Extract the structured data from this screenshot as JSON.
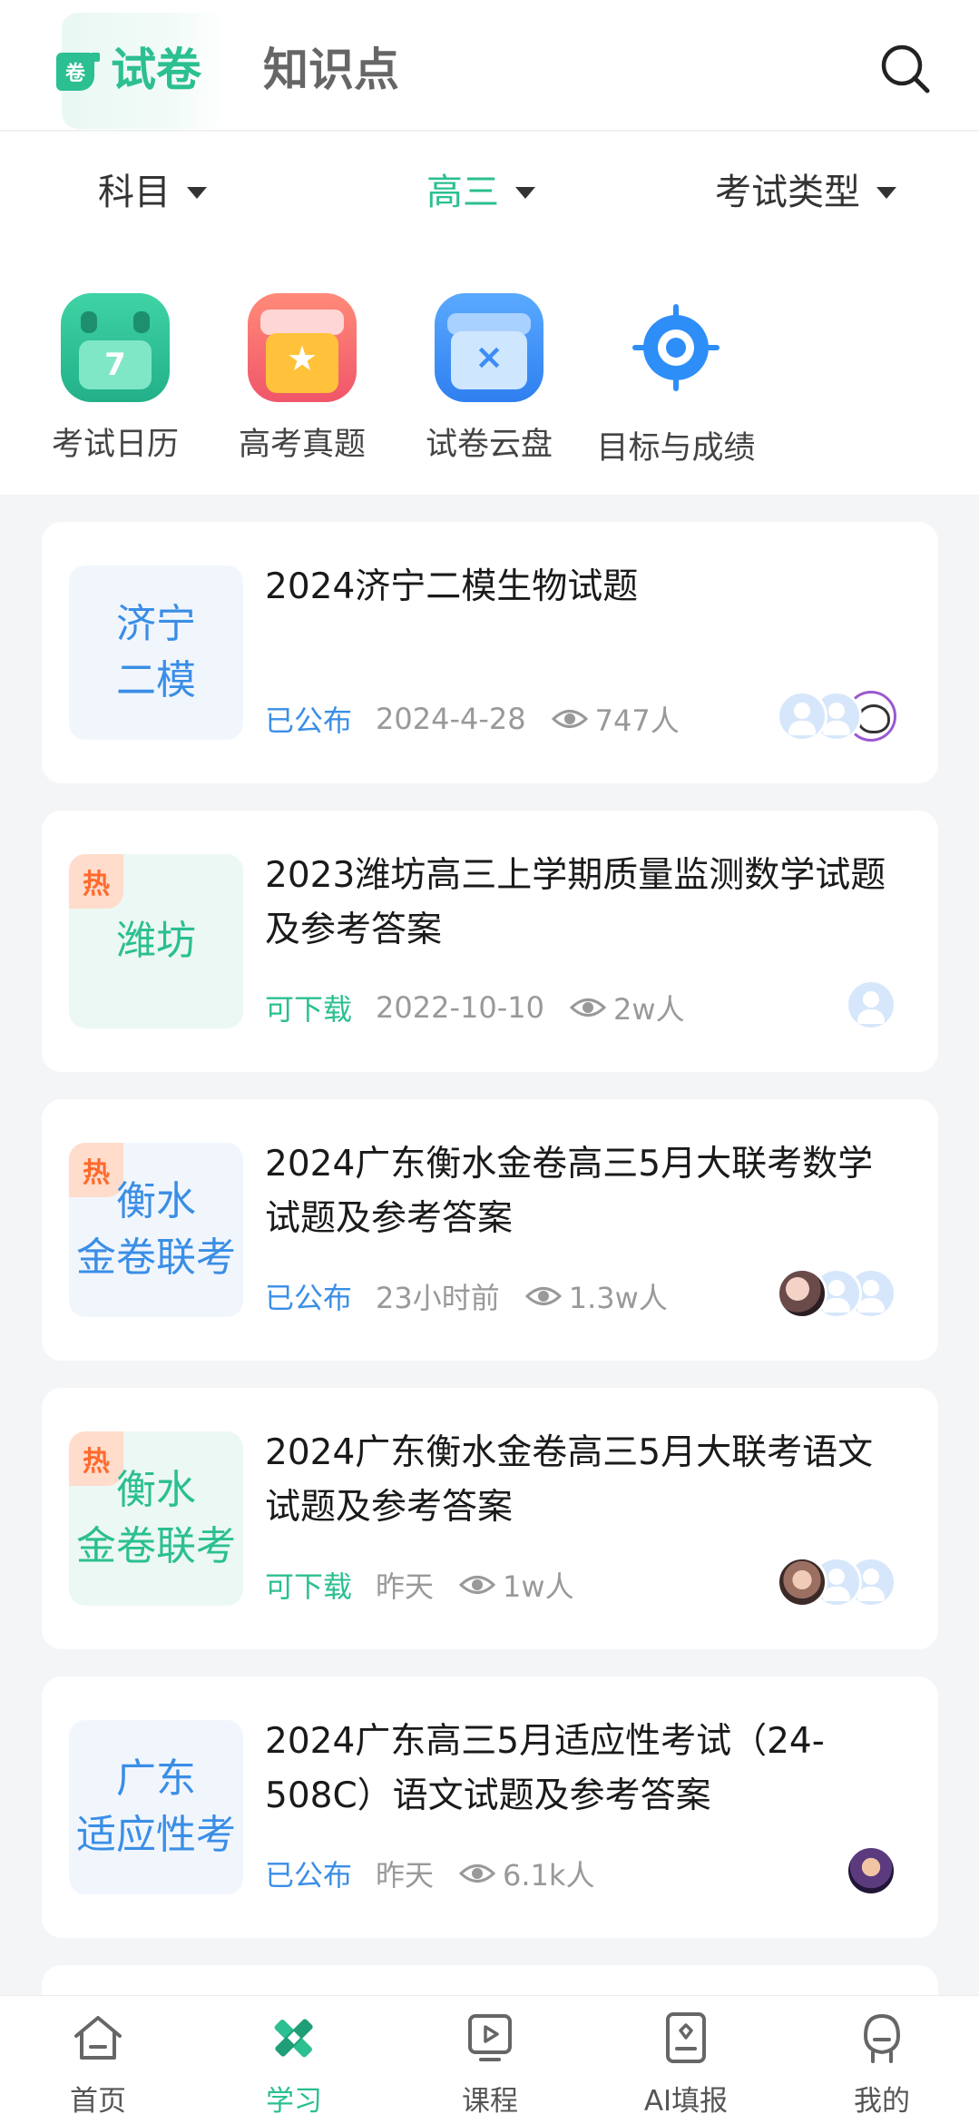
{
  "header": {
    "active_tab_badge": "卷",
    "tabs": [
      {
        "label": "试卷",
        "active": true
      },
      {
        "label": "知识点",
        "active": false
      }
    ],
    "search_icon": "search-icon",
    "accent_color": "#2bbf91"
  },
  "filters": [
    {
      "label": "科目",
      "active": false
    },
    {
      "label": "高三",
      "active": true
    },
    {
      "label": "考试类型",
      "active": false
    }
  ],
  "quick_entries": [
    {
      "label": "考试日历",
      "icon": "calendar-icon",
      "badge": "7"
    },
    {
      "label": "高考真题",
      "icon": "star-folder-icon"
    },
    {
      "label": "试卷云盘",
      "icon": "cloud-box-icon"
    },
    {
      "label": "目标与成绩",
      "icon": "target-icon"
    }
  ],
  "papers": [
    {
      "thumb_lines": [
        "济宁",
        "二模"
      ],
      "thumb_color": "blue",
      "hot": false,
      "title": "2024济宁二模生物试题",
      "status": "已公布",
      "status_color": "blue",
      "date": "2024-4-28",
      "views": "747人"
    },
    {
      "thumb_lines": [
        "潍坊"
      ],
      "thumb_color": "green",
      "hot": true,
      "hot_label": "热",
      "title": "2023潍坊高三上学期质量监测数学试题及参考答案",
      "status": "可下载",
      "status_color": "green",
      "date": "2022-10-10",
      "views": "2w人"
    },
    {
      "thumb_lines": [
        "衡水",
        "金卷联考"
      ],
      "thumb_color": "blue",
      "hot": true,
      "hot_label": "热",
      "title": "2024广东衡水金卷高三5月大联考数学试题及参考答案",
      "status": "已公布",
      "status_color": "blue",
      "date": "23小时前",
      "views": "1.3w人"
    },
    {
      "thumb_lines": [
        "衡水",
        "金卷联考"
      ],
      "thumb_color": "green",
      "hot": true,
      "hot_label": "热",
      "title": "2024广东衡水金卷高三5月大联考语文试题及参考答案",
      "status": "可下载",
      "status_color": "green",
      "date": "昨天",
      "views": "1w人"
    },
    {
      "thumb_lines": [
        "广东",
        "适应性考"
      ],
      "thumb_color": "blue",
      "hot": false,
      "title": "2024广东高三5月适应性考试（24-508C）语文试题及参考答案",
      "status": "已公布",
      "status_color": "blue",
      "date": "昨天",
      "views": "6.1k人"
    }
  ],
  "bottom_nav": [
    {
      "label": "首页",
      "icon": "home-icon",
      "active": false
    },
    {
      "label": "学习",
      "icon": "pencil-ruler-icon",
      "active": true
    },
    {
      "label": "课程",
      "icon": "video-course-icon",
      "active": false
    },
    {
      "label": "AI填报",
      "icon": "ai-form-icon",
      "active": false
    },
    {
      "label": "我的",
      "icon": "profile-icon",
      "active": false
    }
  ]
}
